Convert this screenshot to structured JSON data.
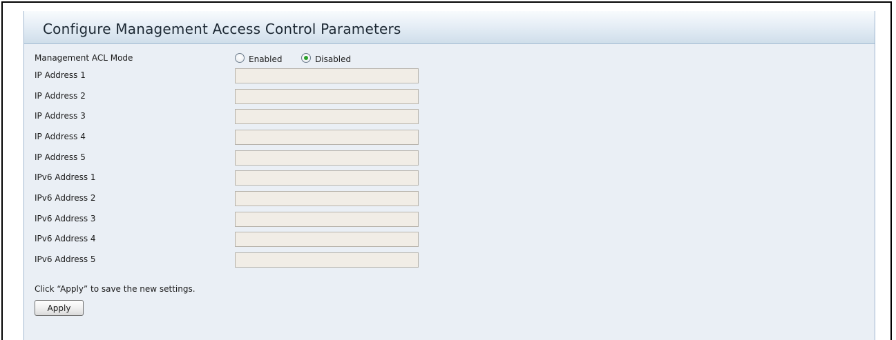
{
  "panel": {
    "title": "Configure Management Access Control Parameters"
  },
  "acl_mode": {
    "label": "Management ACL Mode",
    "options": [
      {
        "label": "Enabled",
        "selected": false
      },
      {
        "label": "Disabled",
        "selected": true
      }
    ]
  },
  "fields": [
    {
      "label": "IP Address 1",
      "value": ""
    },
    {
      "label": "IP Address 2",
      "value": ""
    },
    {
      "label": "IP Address 3",
      "value": ""
    },
    {
      "label": "IP Address 4",
      "value": ""
    },
    {
      "label": "IP Address 5",
      "value": ""
    },
    {
      "label": "IPv6 Address 1",
      "value": ""
    },
    {
      "label": "IPv6 Address 2",
      "value": ""
    },
    {
      "label": "IPv6 Address 3",
      "value": ""
    },
    {
      "label": "IPv6 Address 4",
      "value": ""
    },
    {
      "label": "IPv6 Address 5",
      "value": ""
    }
  ],
  "footer": {
    "hint": "Click “Apply” to save the new settings.",
    "apply_label": "Apply"
  },
  "colors": {
    "panel_background": "#eaeff5",
    "input_background": "#f1ede6",
    "radio_selected": "#2aa02a"
  }
}
